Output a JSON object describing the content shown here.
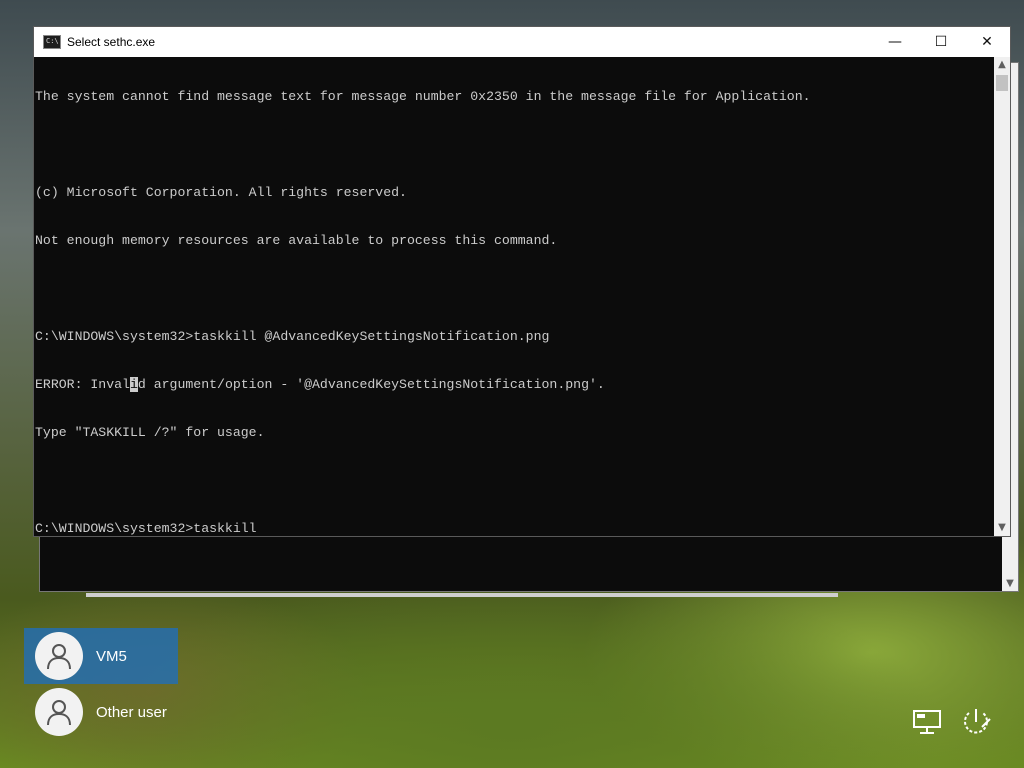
{
  "window": {
    "title": "Select sethc.exe",
    "icon": "console-app-icon",
    "icon_glyph": "C:\\",
    "controls": {
      "minimize": "—",
      "maximize": "☐",
      "close": "✕"
    }
  },
  "console": {
    "lines": [
      "The system cannot find message text for message number 0x2350 in the message file for Application.",
      "",
      "(c) Microsoft Corporation. All rights reserved.",
      "Not enough memory resources are available to process this command.",
      "",
      "C:\\WINDOWS\\system32>taskkill @AdvancedKeySettingsNotification.png",
      "",
      "Type \"TASKKILL /?\" for usage.",
      "",
      "C:\\WINDOWS\\system32>taskkill"
    ],
    "error_line": {
      "before": "ERROR: Inval",
      "selected": "i",
      "after": "d argument/option - '@AdvancedKeySettingsNotification.png'."
    }
  },
  "scrollbar": {
    "up": "▲",
    "down": "▼"
  },
  "users": [
    {
      "name": "VM5",
      "selected": true
    },
    {
      "name": "Other user",
      "selected": false
    }
  ],
  "system_icons": [
    "network-icon",
    "power-icon"
  ],
  "colors": {
    "console_bg": "#0c0c0c",
    "console_fg": "#cccccc",
    "selected_user": "#226eb4"
  }
}
